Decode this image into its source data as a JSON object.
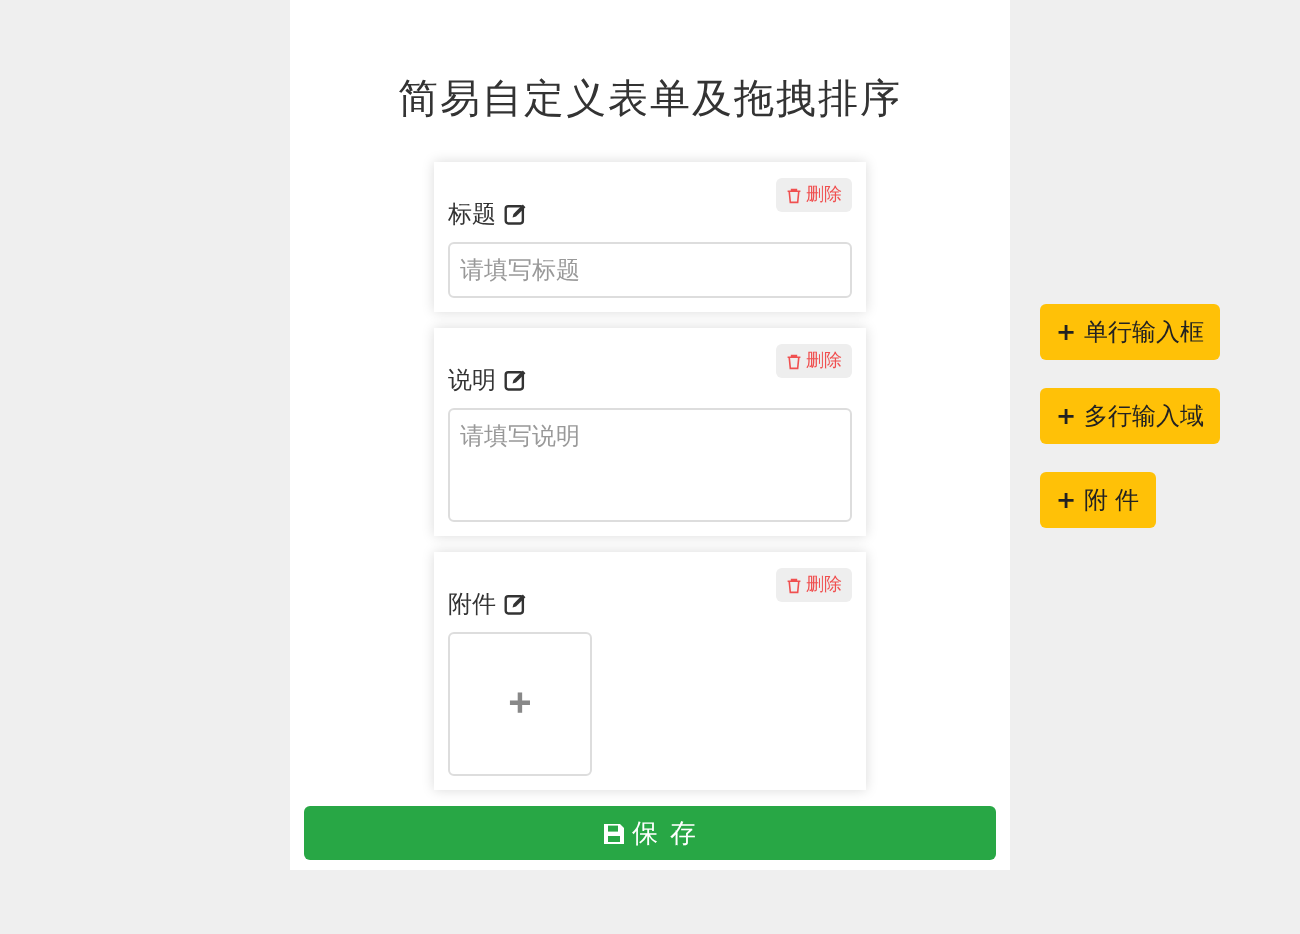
{
  "title": "简易自定义表单及拖拽排序",
  "fields": [
    {
      "kind": "input",
      "label": "标题",
      "placeholder": "请填写标题",
      "delete": "删除"
    },
    {
      "kind": "textarea",
      "label": "说明",
      "placeholder": "请填写说明",
      "delete": "删除"
    },
    {
      "kind": "upload",
      "label": "附件",
      "add": "+",
      "delete": "删除"
    }
  ],
  "save": "保 存",
  "add_buttons": [
    {
      "icon": "+",
      "label": "单行输入框"
    },
    {
      "icon": "+",
      "label": "多行输入域"
    },
    {
      "icon": "+",
      "label": "附 件"
    }
  ]
}
